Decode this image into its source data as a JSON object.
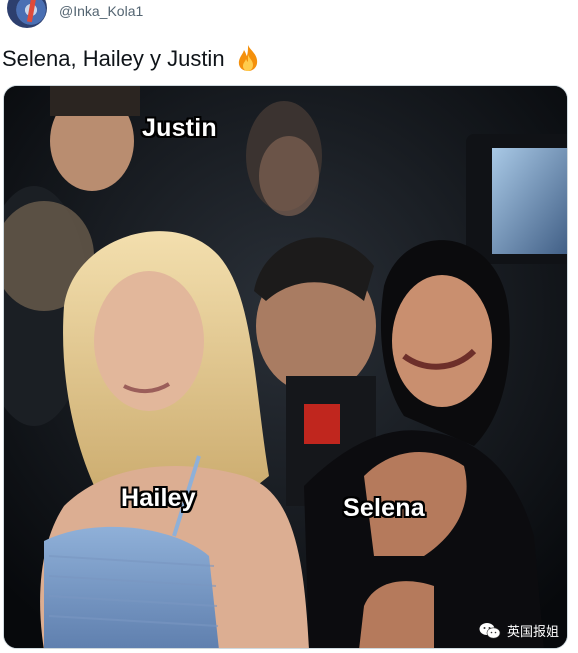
{
  "tweet": {
    "handle": "@Inka_Kola1",
    "text": "Selena, Hailey y Justin",
    "emoji": "fire-emoji"
  },
  "media": {
    "labels": {
      "justin": "Justin",
      "hailey": "Hailey",
      "selena": "Selena"
    },
    "watermark": "英国报姐"
  },
  "colors": {
    "handle": "#536471",
    "text": "#0f1419",
    "label_fill": "#ffffff",
    "label_outline": "#000000"
  }
}
